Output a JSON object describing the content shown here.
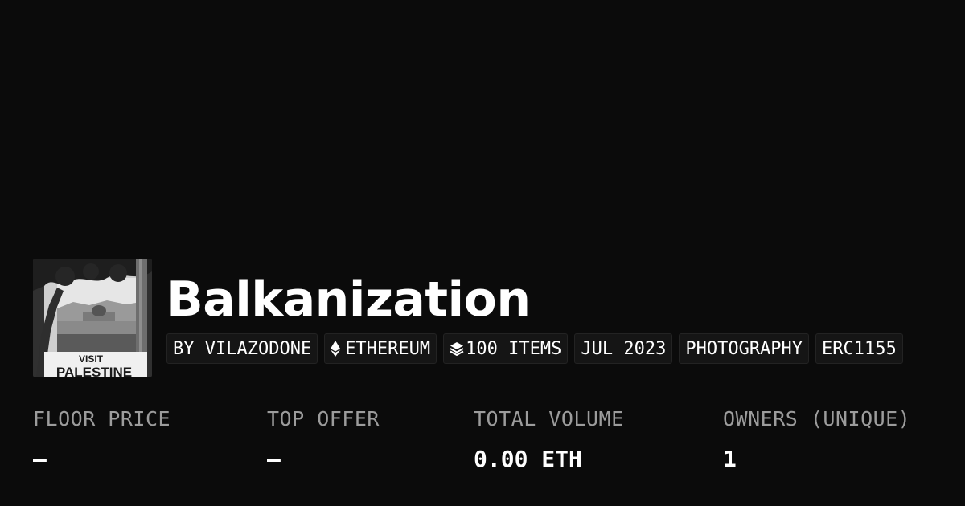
{
  "collection": {
    "title": "Balkanization",
    "thumbnail_caption_line1": "VISIT",
    "thumbnail_caption_line2": "PALESTINE"
  },
  "tags": {
    "creator": "BY VILAZODONE",
    "chain": "ETHEREUM",
    "chain_icon": "ethereum-icon",
    "items": "100 ITEMS",
    "items_icon": "layers-icon",
    "date": "JUL 2023",
    "category": "PHOTOGRAPHY",
    "standard": "ERC1155"
  },
  "stats": {
    "floor_price": {
      "label": "FLOOR PRICE",
      "value": "—"
    },
    "top_offer": {
      "label": "TOP OFFER",
      "value": "—"
    },
    "total_volume": {
      "label": "TOTAL VOLUME",
      "value": "0.00 ETH"
    },
    "owners": {
      "label": "OWNERS (UNIQUE)",
      "value": "1"
    }
  },
  "colors": {
    "background": "#0b0b0b",
    "text": "#ffffff",
    "muted_label": "#9c9c9c",
    "tag_background": "#151515"
  }
}
